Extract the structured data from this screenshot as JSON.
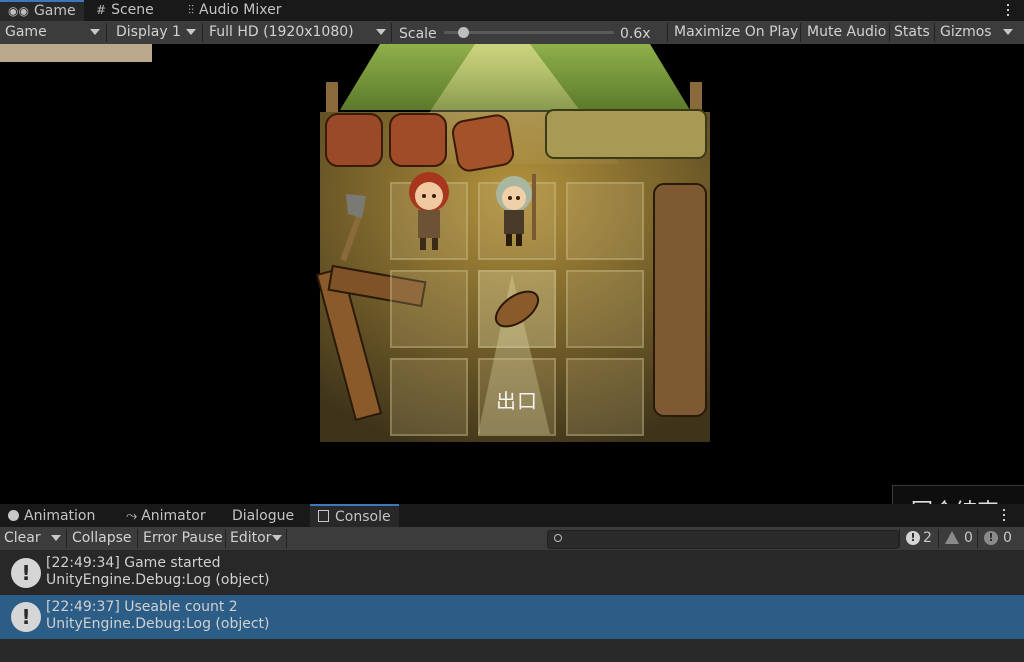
{
  "top_tabs": [
    {
      "label": "Game",
      "icon": "gamepad-icon"
    },
    {
      "label": "Scene",
      "icon": "grid-icon"
    },
    {
      "label": "Audio Mixer",
      "icon": "mixer-icon"
    }
  ],
  "game_toolbar": {
    "view": "Game",
    "display": "Display 1",
    "resolution": "Full HD (1920x1080)",
    "scale_label": "Scale",
    "scale_value": "0.6x",
    "scale_fraction": 0.09,
    "maximize": "Maximize On Play",
    "mute": "Mute Audio",
    "stats": "Stats",
    "gizmos": "Gizmos"
  },
  "game": {
    "exit_label": "出口",
    "corner_text": "回合结束"
  },
  "bottom_tabs": [
    {
      "label": "Animation",
      "icon": "clock-icon"
    },
    {
      "label": "Animator",
      "icon": "animator-icon"
    },
    {
      "label": "Dialogue",
      "icon": ""
    },
    {
      "label": "Console",
      "icon": "console-icon"
    }
  ],
  "console_toolbar": {
    "clear": "Clear",
    "collapse": "Collapse",
    "error_pause": "Error Pause",
    "editor": "Editor",
    "search_placeholder": "",
    "info_count": "2",
    "warn_count": "0",
    "error_count": "0"
  },
  "logs": [
    {
      "line1": "[22:49:34] Game started",
      "line2": "UnityEngine.Debug:Log (object)",
      "selected": false
    },
    {
      "line1": "[22:49:37] Useable count 2",
      "line2": "UnityEngine.Debug:Log (object)",
      "selected": true
    }
  ],
  "colors": {
    "accent": "#3a79bb",
    "selected_row": "#2c5d87"
  }
}
